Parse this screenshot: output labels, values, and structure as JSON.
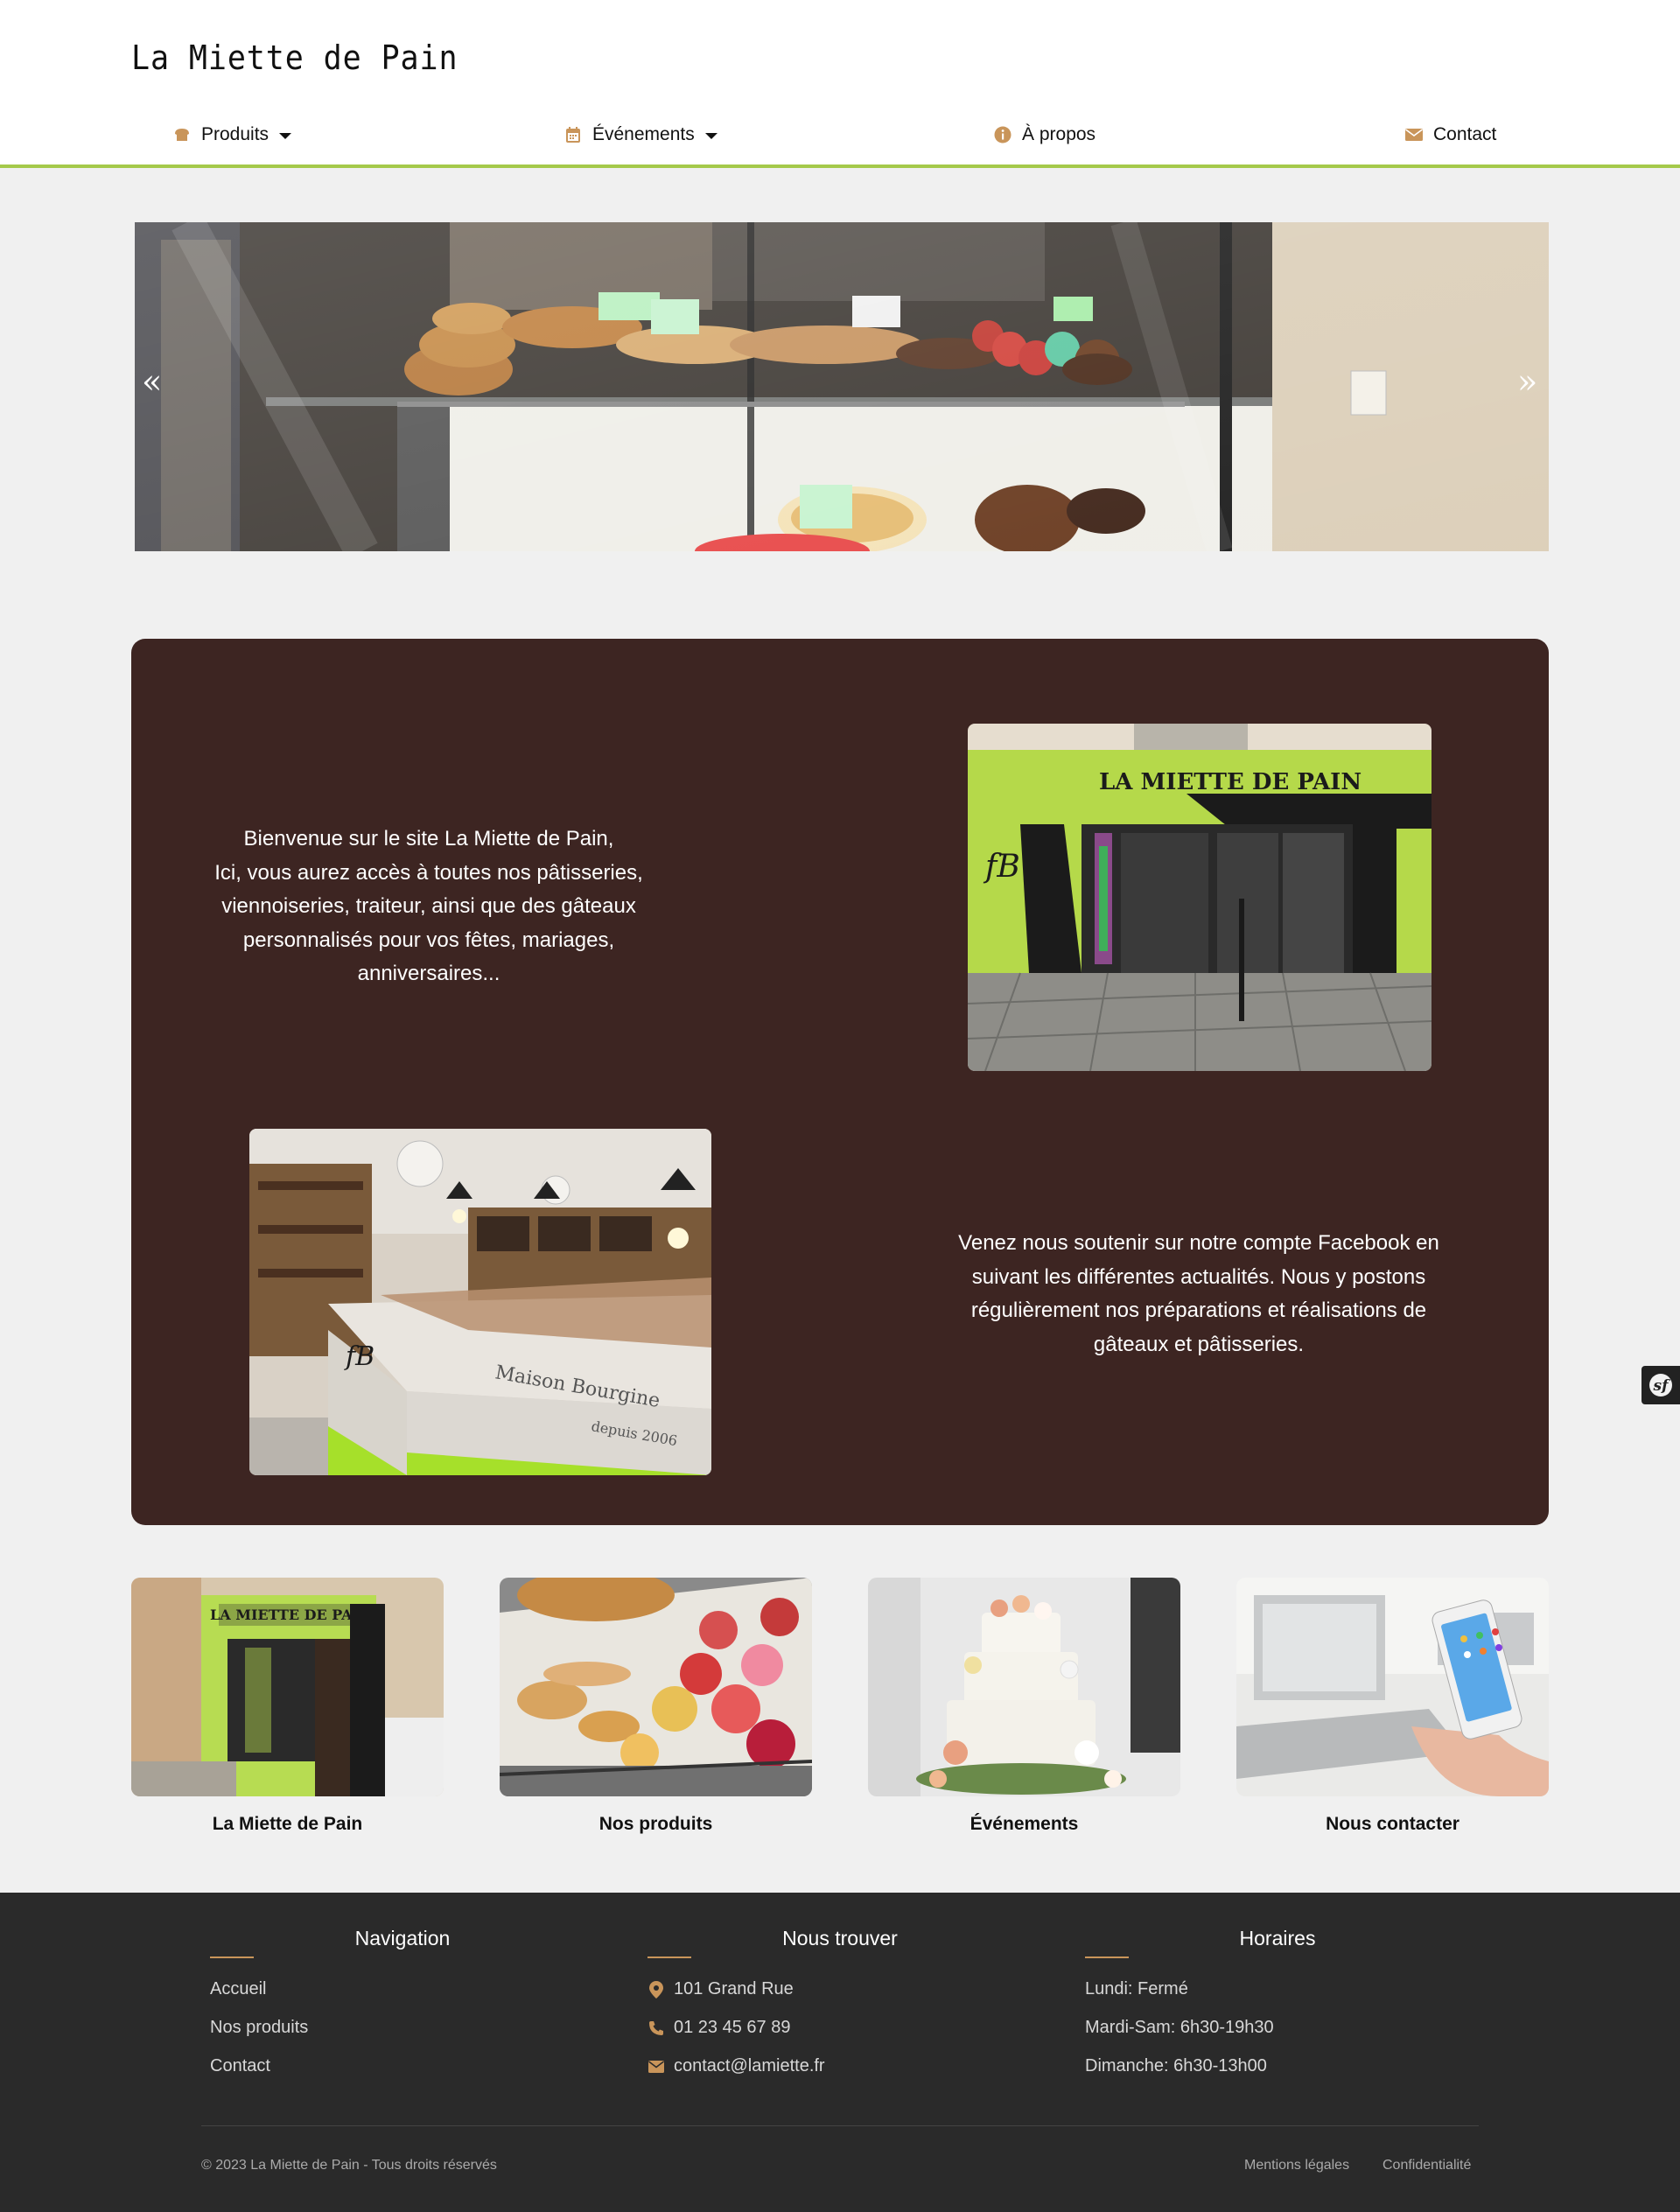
{
  "brand": {
    "name": "La Miette de Pain"
  },
  "nav": {
    "produits": "Produits",
    "evenements": "Événements",
    "apropos": "À propos",
    "contact": "Contact"
  },
  "carousel": {
    "prev": "«",
    "next": "»"
  },
  "intro": {
    "welcome": [
      "Bienvenue sur le site La Miette de Pain,",
      "Ici, vous aurez accès à toutes nos pâtisseries,",
      "viennoiseries, traiteur, ainsi que des gâteaux",
      "personnalisés pour vos fêtes, mariages, anniversaires..."
    ],
    "facebook": [
      "Venez nous soutenir sur notre compte Facebook en",
      "suivant les différentes actualités. Nous y postons",
      "régulièrement nos préparations et réalisations de",
      "gâteaux et pâtisseries."
    ],
    "shop_sign": "LA MIETTE DE PAIN",
    "counter_sign": "Maison Bourgine",
    "counter_since": "depuis 2006"
  },
  "cards": [
    {
      "title": "La Miette de Pain"
    },
    {
      "title": "Nos produits"
    },
    {
      "title": "Événements"
    },
    {
      "title": "Nous contacter"
    }
  ],
  "footer": {
    "navigation": {
      "title": "Navigation",
      "links": [
        "Accueil",
        "Nos produits",
        "Contact"
      ]
    },
    "trouver": {
      "title": "Nous trouver",
      "address": "101 Grand Rue",
      "phone": "01 23 45 67 89",
      "email": "contact@lamiette.fr"
    },
    "horaires": {
      "title": "Horaires",
      "lines": [
        "Lundi: Fermé",
        "Mardi-Sam: 6h30-19h30",
        "Dimanche: 6h30-13h00"
      ]
    },
    "copyright": "© 2023 La Miette de Pain - Tous droits réservés",
    "mentions": "Mentions légales",
    "confidentialite": "Confidentialité"
  },
  "colors": {
    "accent": "#c9955a",
    "green": "#a4c94a",
    "panel": "#3d2522",
    "footer": "#2a2a2a"
  },
  "icons": {
    "produits": "bread-icon",
    "evenements": "calendar-icon",
    "apropos": "info-icon",
    "contact": "envelope-icon"
  }
}
